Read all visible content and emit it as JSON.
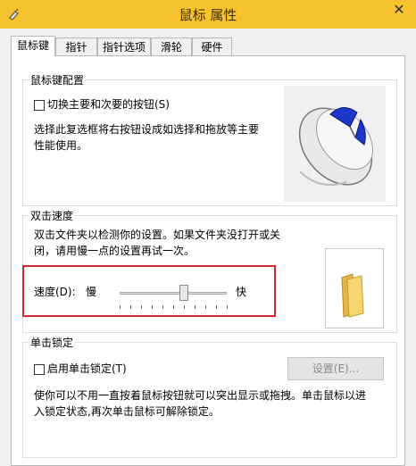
{
  "window": {
    "title": "鼠标 属性"
  },
  "tabs": [
    {
      "label": "鼠标键",
      "active": true
    },
    {
      "label": "指针",
      "active": false
    },
    {
      "label": "指针选项",
      "active": false
    },
    {
      "label": "滑轮",
      "active": false
    },
    {
      "label": "硬件",
      "active": false
    }
  ],
  "button_config": {
    "title": "鼠标键配置",
    "checkbox_label": "切换主要和次要的按钮(S)",
    "checkbox_checked": false,
    "desc_line1": "选择此复选框将右按钮设成如选择和拖放等主要",
    "desc_line2": "性能使用。"
  },
  "double_click": {
    "title": "双击速度",
    "desc_line1": "双击文件夹以检测你的设置。如果文件夹没打开或关",
    "desc_line2": "闭，请用慢一点的设置再试一次。",
    "speed_label": "速度(D):",
    "slow_label": "慢",
    "fast_label": "快",
    "speed_fraction": 0.6
  },
  "click_lock": {
    "title": "单击锁定",
    "checkbox_label": "启用单击锁定(T)",
    "checkbox_checked": false,
    "settings_button": "设置(E)...",
    "desc_line1": "使你可以不用一直按着鼠标按钮就可以突出显示或拖拽。单击鼠标以进",
    "desc_line2": "入锁定状态,再次单击鼠标可解除锁定。"
  },
  "colors": {
    "titlebar": "#f6c32e",
    "highlight": "#d9262c"
  }
}
